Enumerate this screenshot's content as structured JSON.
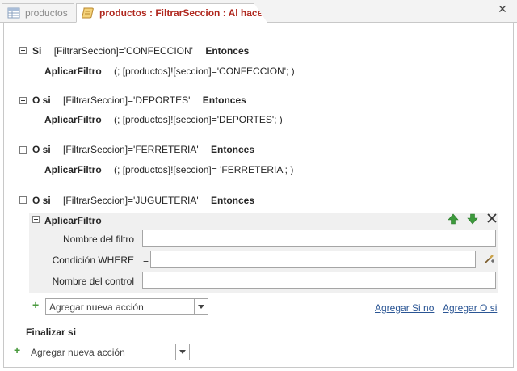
{
  "tabs": [
    {
      "label": "productos",
      "icon": "table-icon"
    },
    {
      "label": "productos : FiltrarSeccion : Al hacer clic",
      "icon": "macro-icon"
    }
  ],
  "blocks": [
    {
      "keyword": "Si",
      "condition": "[FiltrarSeccion]='CONFECCION'",
      "then": "Entonces",
      "action": "AplicarFiltro",
      "args": "(; [productos]![seccion]='CONFECCION'; )"
    },
    {
      "keyword": "O si",
      "condition": "[FiltrarSeccion]='DEPORTES'",
      "then": "Entonces",
      "action": "AplicarFiltro",
      "args": "(; [productos]![seccion]='DEPORTES'; )"
    },
    {
      "keyword": "O si",
      "condition": "[FiltrarSeccion]='FERRETERIA'",
      "then": "Entonces",
      "action": "AplicarFiltro",
      "args": "(; [productos]![seccion]= 'FERRETERIA'; )"
    },
    {
      "keyword": "O si",
      "condition": "[FiltrarSeccion]='JUGUETERIA'",
      "then": "Entonces"
    }
  ],
  "editor": {
    "action": "AplicarFiltro",
    "fields": {
      "filter_name": {
        "label": "Nombre del filtro",
        "value": ""
      },
      "where": {
        "label": "Condición WHERE",
        "prefix": "=",
        "value": ""
      },
      "control_name": {
        "label": "Nombre del control",
        "value": ""
      }
    }
  },
  "add_action": {
    "placeholder": "Agregar nueva acción"
  },
  "links": {
    "add_else": "Agregar Si no",
    "add_else_if": "Agregar O si"
  },
  "end_if": {
    "label": "Finalizar si"
  },
  "add_action_outer": {
    "placeholder": "Agregar nueva acción"
  }
}
